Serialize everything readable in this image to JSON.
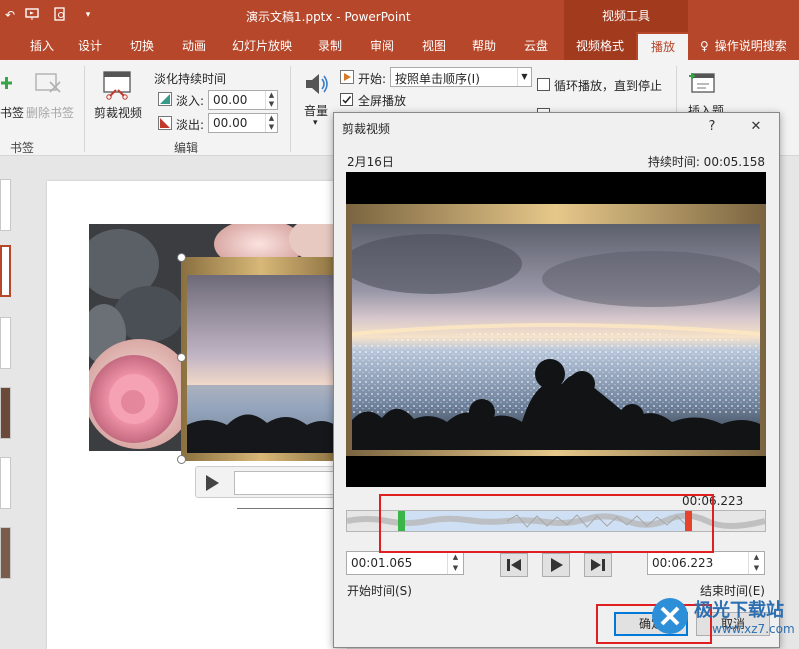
{
  "titlebar": {
    "document_title": "演示文稿1.pptx  -  PowerPoint",
    "context_header": "视频工具"
  },
  "tabs": [
    "插入",
    "设计",
    "切换",
    "动画",
    "幻灯片放映",
    "录制",
    "审阅",
    "视图",
    "帮助",
    "云盘",
    "视频格式",
    "播放"
  ],
  "tell_me": "操作说明搜索",
  "ribbon": {
    "bookmark_add": "书签",
    "bookmark_remove": "删除书签",
    "bookmark_group": "书签",
    "trim_video": "剪裁视频",
    "fade_duration": "淡化持续时间",
    "fade_in_label": "淡入:",
    "fade_in_value": "00.00",
    "fade_out_label": "淡出:",
    "fade_out_value": "00.00",
    "edit_group": "编辑",
    "volume": "音量",
    "start_label": "开始:",
    "start_value": "按照单击顺序(I)",
    "fullscreen": "全屏播放",
    "fullscreen_checked": true,
    "loop": "循环播放，直到停止",
    "loop_checked": false,
    "insert_caption": "插入题"
  },
  "dialog": {
    "title": "剪裁视频",
    "help": "?",
    "close": "✕",
    "file_name": "2月16日",
    "duration_label": "持续时间: 00:05.158",
    "marker_time": "00:06.223",
    "start_time_value": "00:01.065",
    "end_time_value": "00:06.223",
    "start_time_label": "开始时间(S)",
    "end_time_label": "结束时间(E)",
    "ok": "确定",
    "cancel": "取消",
    "trim_start_fraction": 0.13,
    "trim_end_fraction": 0.815
  },
  "watermark": {
    "brand": "极光下载站",
    "url": "www.xz7.com"
  },
  "colors": {
    "accent": "#b7472a",
    "highlight_box": "#e02020",
    "start_marker": "#39b54a",
    "end_marker": "#e8412c"
  }
}
